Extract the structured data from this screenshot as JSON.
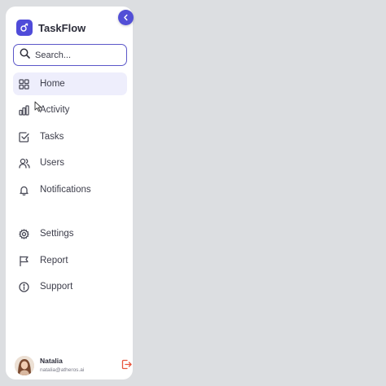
{
  "brand": {
    "name": "TaskFlow",
    "accent": "#4f4bd9"
  },
  "search": {
    "placeholder": "Search..."
  },
  "nav": {
    "items": [
      {
        "label": "Home",
        "icon": "grid-icon",
        "active": true
      },
      {
        "label": "Activity",
        "icon": "bar-chart-icon"
      },
      {
        "label": "Tasks",
        "icon": "check-square-icon"
      },
      {
        "label": "Users",
        "icon": "users-icon"
      },
      {
        "label": "Notifications",
        "icon": "bell-icon"
      }
    ],
    "secondary": [
      {
        "label": "Settings",
        "icon": "gear-icon"
      },
      {
        "label": "Report",
        "icon": "flag-icon"
      },
      {
        "label": "Support",
        "icon": "info-icon"
      }
    ]
  },
  "user": {
    "name": "Natalia",
    "email": "natalia@atheros.ai"
  },
  "colors": {
    "background": "#dcdee1",
    "sidebar": "#ffffff",
    "active_item": "#eeeefc",
    "logout": "#e8553d"
  }
}
